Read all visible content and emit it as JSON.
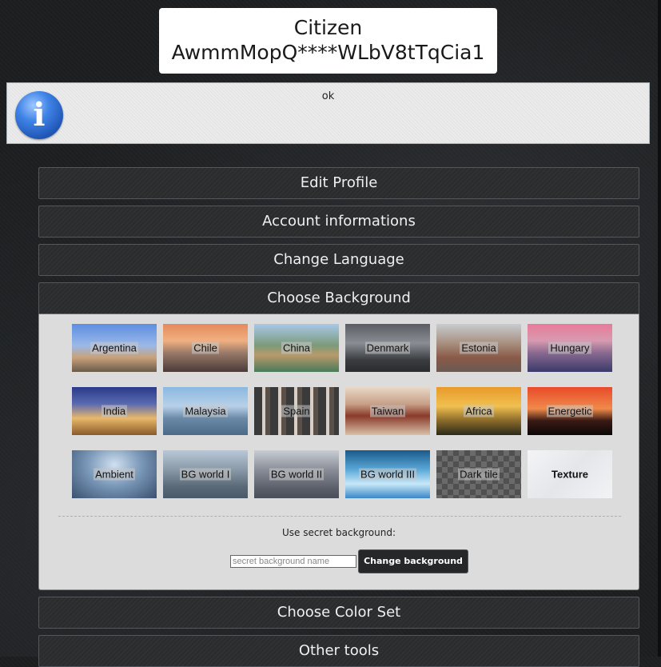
{
  "title": {
    "line1": "Citizen",
    "line2": "AwmmMopQ****WLbV8tTqCia1"
  },
  "info": {
    "icon": "info-icon",
    "glyph": "i",
    "message": "ok"
  },
  "sections": {
    "edit_profile": "Edit Profile",
    "account_info": "Account informations",
    "change_language": "Change Language",
    "choose_background": "Choose Background",
    "choose_color_set": "Choose Color Set",
    "other_tools": "Other tools"
  },
  "backgrounds": [
    {
      "label": "Argentina"
    },
    {
      "label": "Chile"
    },
    {
      "label": "China"
    },
    {
      "label": "Denmark"
    },
    {
      "label": "Estonia"
    },
    {
      "label": "Hungary"
    },
    {
      "label": "India"
    },
    {
      "label": "Malaysia"
    },
    {
      "label": "Spain"
    },
    {
      "label": "Taiwan"
    },
    {
      "label": "Africa"
    },
    {
      "label": "Energetic"
    },
    {
      "label": "Ambient"
    },
    {
      "label": "BG world I"
    },
    {
      "label": "BG world II"
    },
    {
      "label": "BG world III"
    },
    {
      "label": "Dark tile"
    },
    {
      "label": "Texture"
    }
  ],
  "secret": {
    "label": "Use secret background:",
    "placeholder": "secret background name",
    "button": "Change background"
  }
}
